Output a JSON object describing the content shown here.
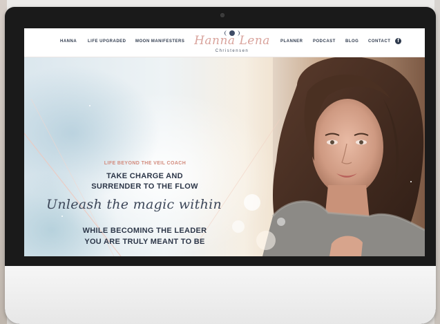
{
  "nav": {
    "left_items": [
      "HANNA",
      "LIFE UPGRADED",
      "MOON MANIFESTERS"
    ],
    "right_items": [
      "PLANNER",
      "PODCAST",
      "BLOG",
      "CONTACT"
    ],
    "social_icon": "facebook-icon"
  },
  "logo": {
    "script": "Hanna Lena",
    "sub": "Christensen"
  },
  "hero": {
    "eyebrow": "LIFE BEYOND THE VEIL COACH",
    "headline_1": "TAKE CHARGE AND",
    "headline_2": "SURRENDER TO THE FLOW",
    "script": "Unleash the magic within",
    "subline_1": "WHILE BECOMING THE LEADER",
    "subline_2": "YOU ARE TRULY MEANT TO BE"
  },
  "colors": {
    "accent": "#d28a7c",
    "logo": "#d9a39c",
    "navy": "#2c3648"
  }
}
